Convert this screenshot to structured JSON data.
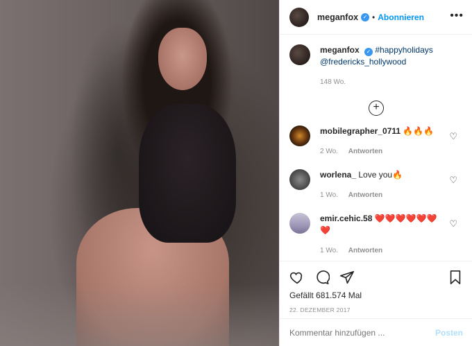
{
  "post_image": {
    "alt_icon": "photo"
  },
  "header": {
    "username": "meganfox",
    "verified_icon": "verified-badge-icon",
    "separator": "•",
    "follow_label": "Abonnieren",
    "more_icon": "more-dots-icon"
  },
  "caption": {
    "username": "meganfox",
    "hashtag": "#happyholidays",
    "mention": "@fredericks_hollywood",
    "age": "148 Wo."
  },
  "load_more_icon": "plus-circle-icon",
  "comments": [
    {
      "username": "mobilegrapher_0711",
      "text": "🔥🔥🔥",
      "age": "2 Wo.",
      "reply_label": "Antworten"
    },
    {
      "username": "worlena_",
      "text": "Love you🔥",
      "age": "1 Wo.",
      "reply_label": "Antworten"
    },
    {
      "username": "emir.cehic.58",
      "text": "❤️❤️❤️❤️❤️❤️❤️",
      "age": "1 Wo.",
      "reply_label": "Antworten"
    }
  ],
  "actions": {
    "like_icon": "heart-icon",
    "comment_icon": "comment-icon",
    "share_icon": "share-icon",
    "save_icon": "bookmark-icon"
  },
  "likes_text": "Gefällt 681.574 Mal",
  "date_text": "22. DEZEMBER 2017",
  "comment_input": {
    "placeholder": "Kommentar hinzufügen ...",
    "post_label": "Posten"
  },
  "colors": {
    "link_blue": "#0095f6",
    "verified_blue": "#3897f0",
    "post_disabled": "#b2dffc"
  }
}
